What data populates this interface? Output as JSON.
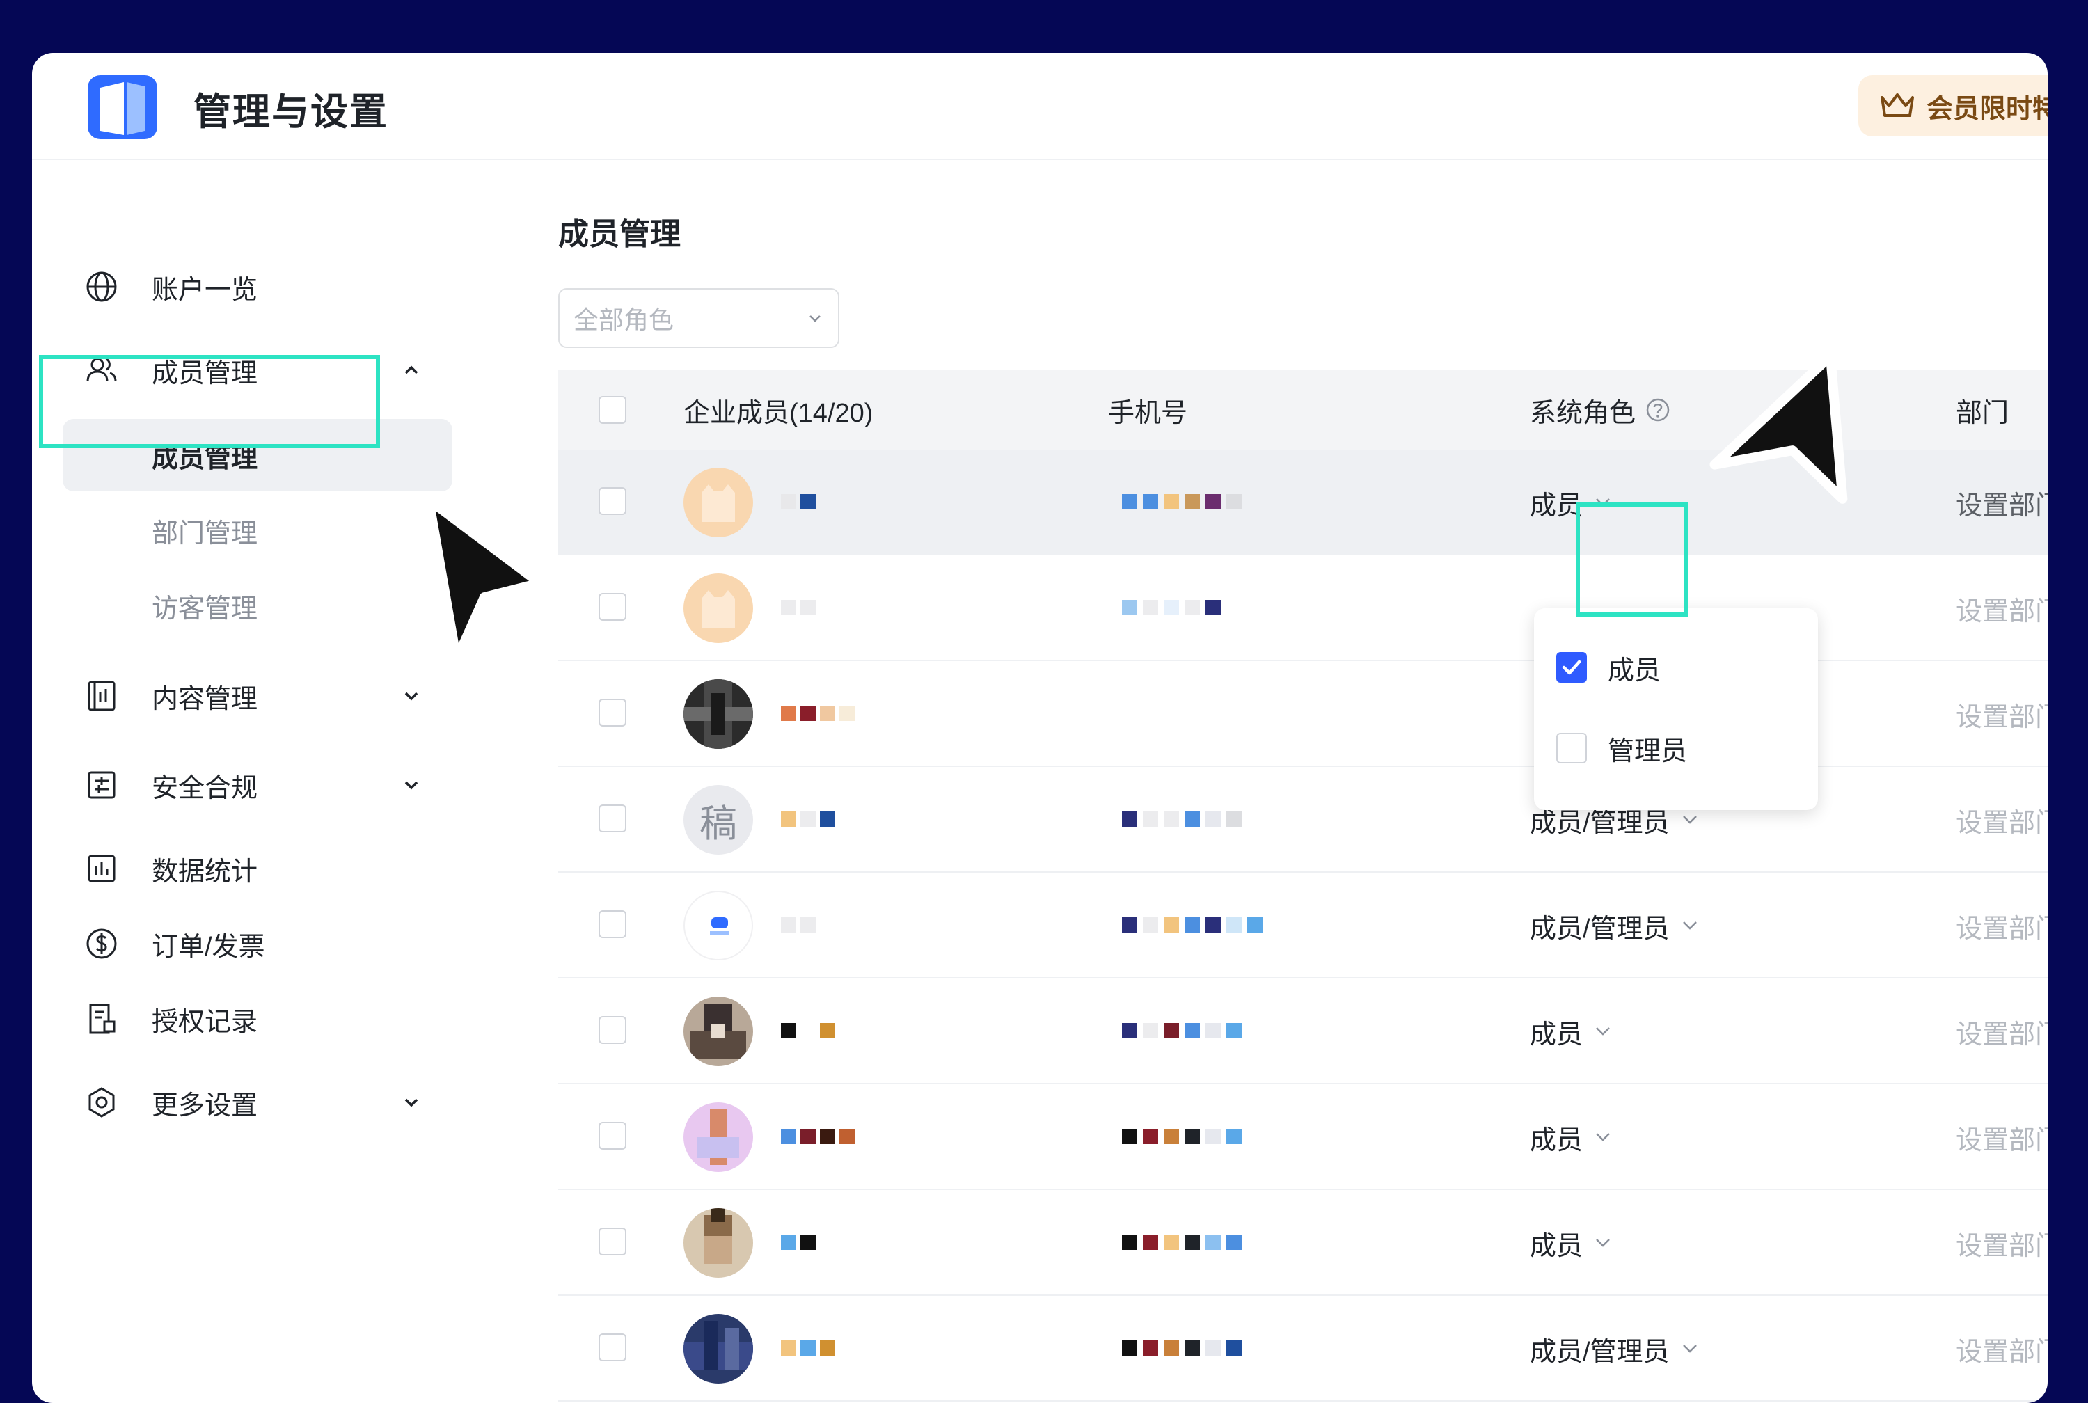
{
  "app": {
    "title": "管理与设置",
    "promo": "会员限时特"
  },
  "sidebar": {
    "items": [
      {
        "label": "账户一览",
        "icon": "globe-icon"
      },
      {
        "label": "成员管理",
        "icon": "users-icon",
        "expanded": true
      },
      {
        "label": "内容管理",
        "icon": "content-icon"
      },
      {
        "label": "安全合规",
        "icon": "security-icon"
      },
      {
        "label": "数据统计",
        "icon": "chart-icon"
      },
      {
        "label": "订单/发票",
        "icon": "dollar-icon"
      },
      {
        "label": "授权记录",
        "icon": "record-icon"
      },
      {
        "label": "更多设置",
        "icon": "settings-icon"
      }
    ],
    "sub_items": [
      {
        "label": "成员管理",
        "active": true
      },
      {
        "label": "部门管理"
      },
      {
        "label": "访客管理"
      }
    ]
  },
  "main": {
    "title": "成员管理",
    "role_filter_placeholder": "全部角色",
    "table": {
      "columns": [
        "企业成员(14/20)",
        "手机号",
        "系统角色",
        "部门"
      ],
      "rows": [
        {
          "role": "成员",
          "dept": "设置部门"
        },
        {
          "role": "",
          "dept": "设置部门"
        },
        {
          "role": "",
          "dept": "设置部门"
        },
        {
          "role": "成员/管理员",
          "dept": "设置部门"
        },
        {
          "role": "成员/管理员",
          "dept": "设置部门"
        },
        {
          "role": "成员",
          "dept": "设置部门"
        },
        {
          "role": "成员",
          "dept": "设置部门"
        },
        {
          "role": "成员",
          "dept": "设置部门"
        },
        {
          "role": "成员/管理员",
          "dept": "设置部门"
        }
      ]
    },
    "role_dropdown": {
      "options": [
        {
          "label": "成员",
          "checked": true
        },
        {
          "label": "管理员",
          "checked": false
        }
      ]
    },
    "avatar_text": "稿"
  },
  "colors": {
    "accent": "#2f5bff",
    "highlight": "#2de3c3",
    "background": "#050755"
  }
}
